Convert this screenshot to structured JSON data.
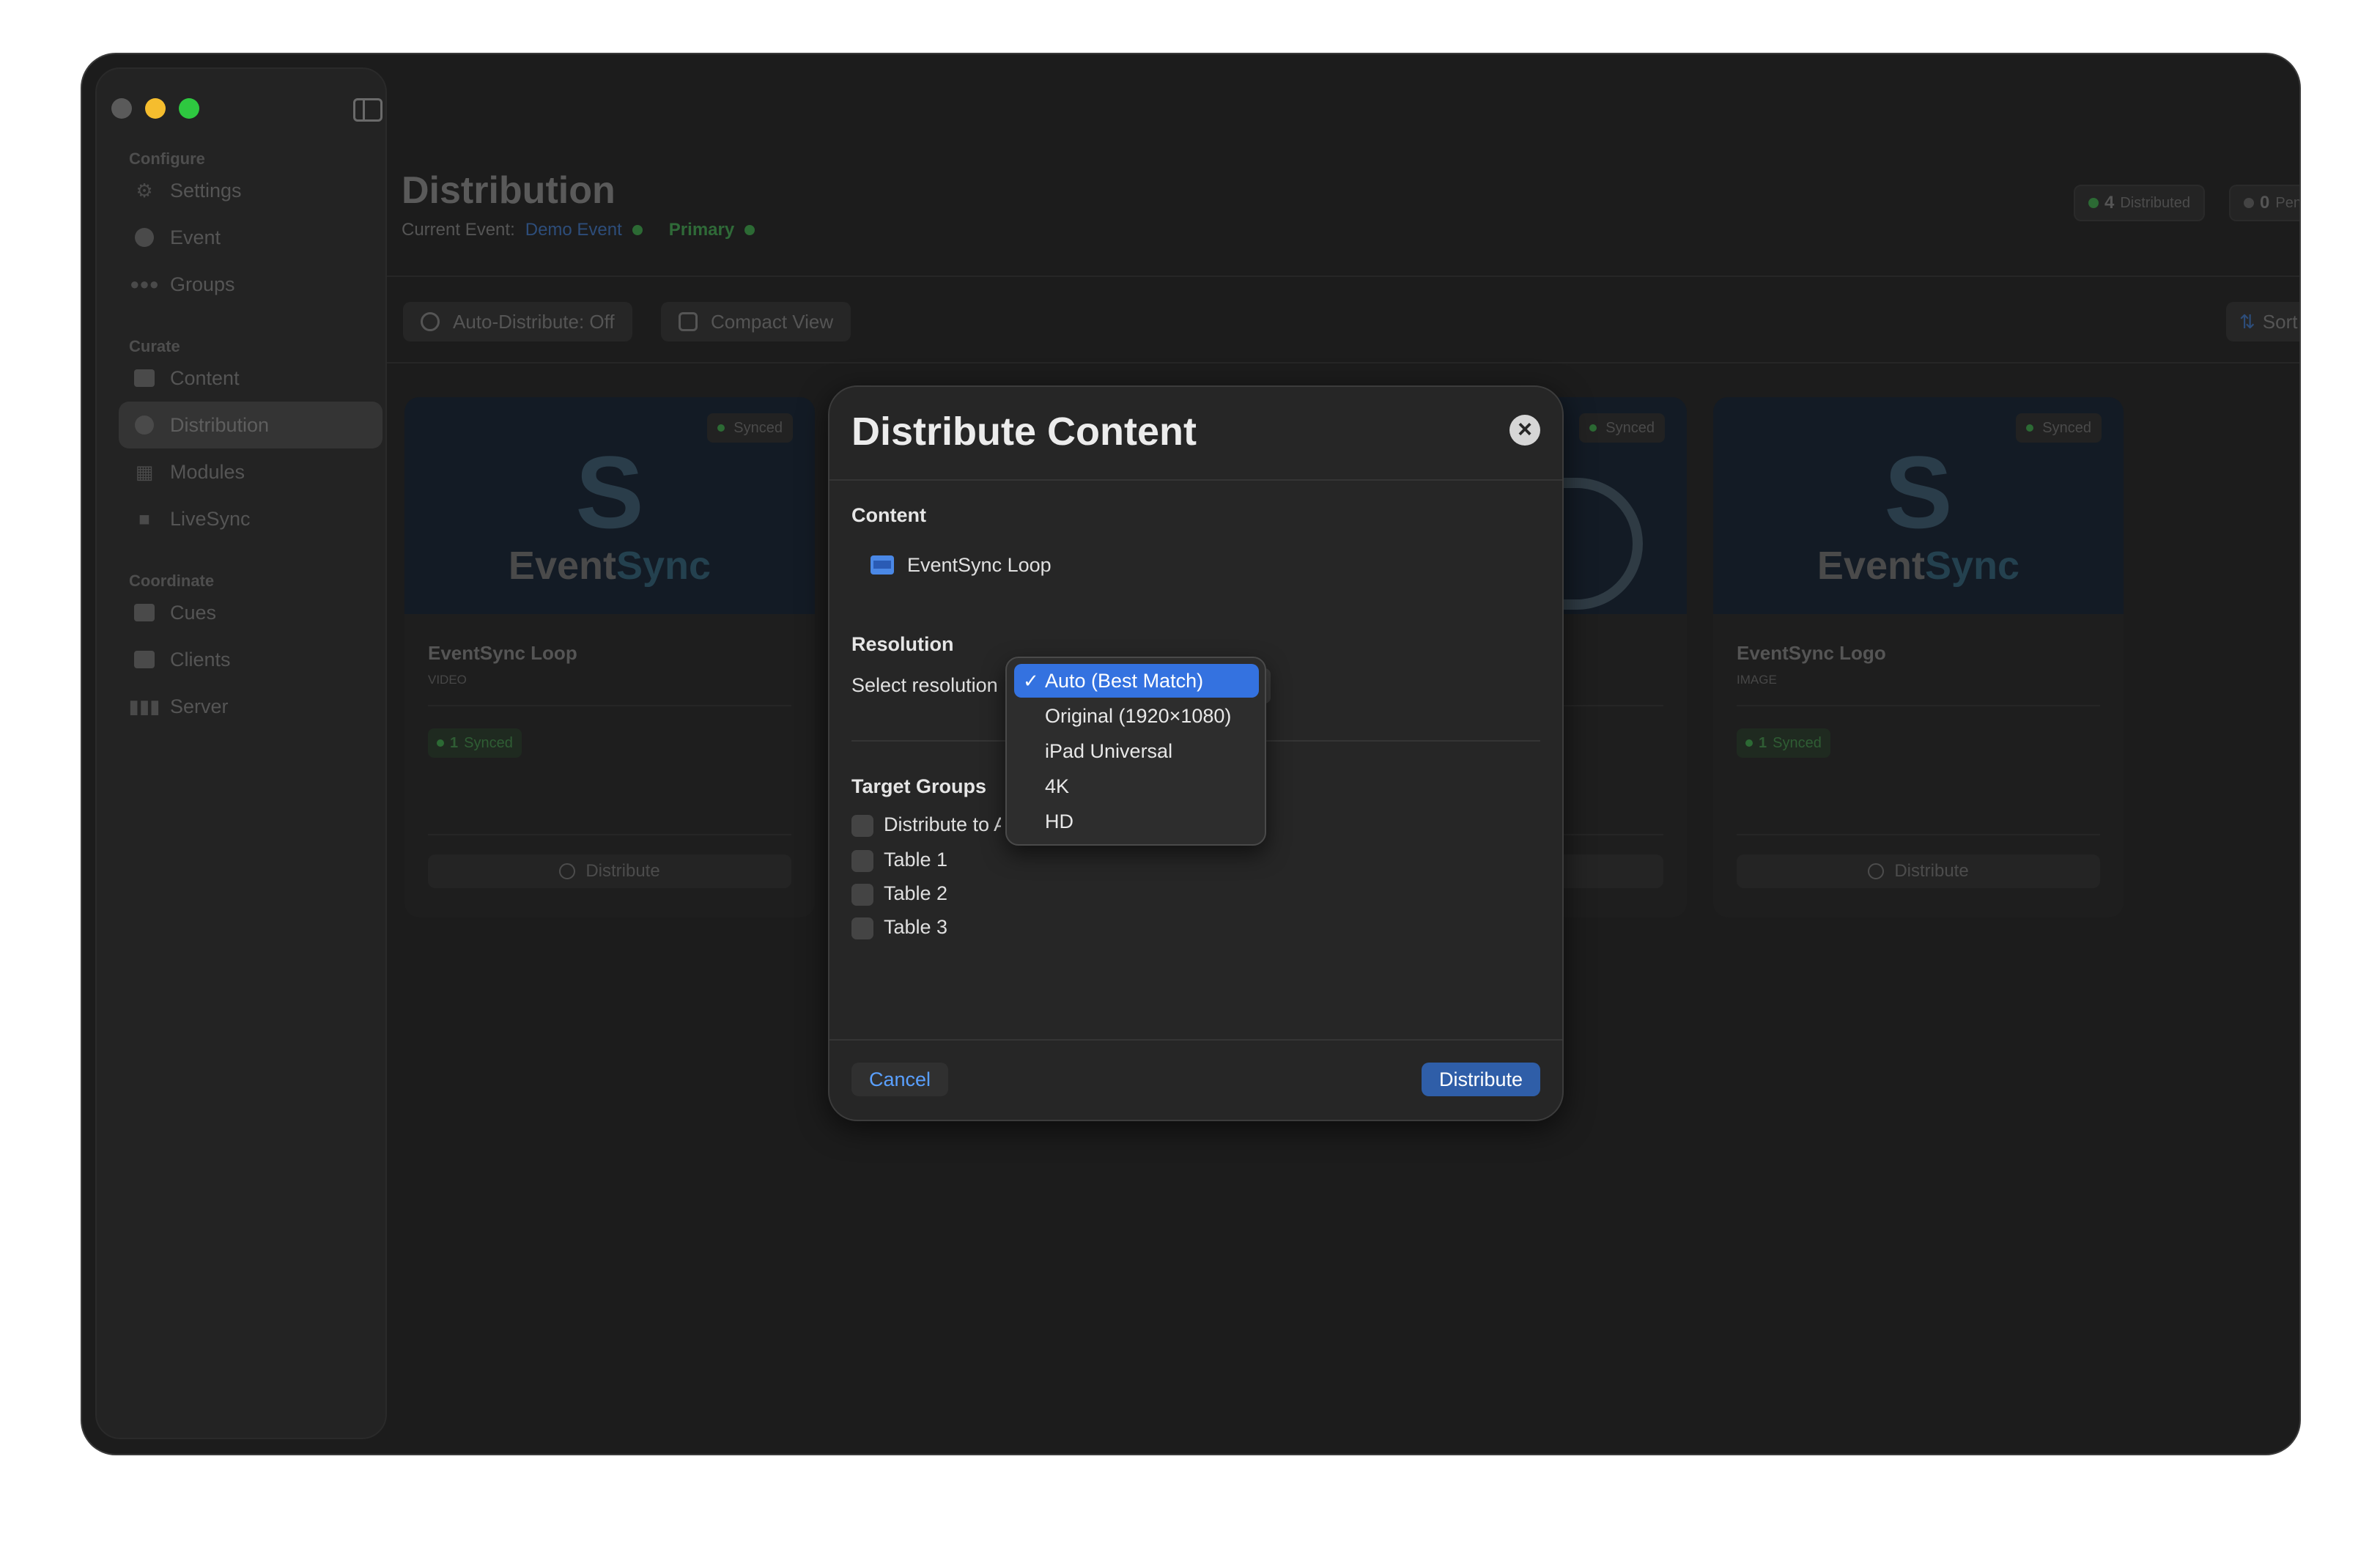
{
  "sidebar": {
    "sections": [
      {
        "title": "Configure",
        "items": [
          {
            "label": "Settings",
            "icon": "gear-icon"
          },
          {
            "label": "Event",
            "icon": "event-icon"
          },
          {
            "label": "Groups",
            "icon": "groups-icon"
          }
        ]
      },
      {
        "title": "Curate",
        "items": [
          {
            "label": "Content",
            "icon": "content-icon"
          },
          {
            "label": "Distribution",
            "icon": "distribution-icon"
          },
          {
            "label": "Modules",
            "icon": "modules-icon"
          },
          {
            "label": "LiveSync",
            "icon": "camera-icon"
          }
        ]
      },
      {
        "title": "Coordinate",
        "items": [
          {
            "label": "Cues",
            "icon": "cues-icon"
          },
          {
            "label": "Clients",
            "icon": "clients-icon"
          },
          {
            "label": "Server",
            "icon": "server-icon"
          }
        ]
      }
    ],
    "active": "Distribution"
  },
  "header": {
    "title": "Distribution",
    "current_event_label": "Current Event:",
    "event_name": "Demo Event",
    "primary_label": "Primary",
    "distributed_count": "4",
    "distributed_label": "Distributed",
    "pending_count": "0",
    "pending_label": "Pending"
  },
  "toolbar": {
    "auto_distribute": "Auto-Distribute: Off",
    "compact_view": "Compact View",
    "sort": "Sort"
  },
  "cards": [
    {
      "title": "EventSync Loop",
      "type": "VIDEO",
      "badge": "Synced",
      "synced_count": "1",
      "synced_label": "Synced",
      "action": "Distribute",
      "logo_a": "Event",
      "logo_b": "Sync"
    },
    {
      "title": "EventSync Logo",
      "type": "IMAGE",
      "badge": "Synced",
      "synced_count": "1",
      "synced_label": "Synced",
      "action": "Distribute",
      "logo_a": "Event",
      "logo_b": "Sync"
    }
  ],
  "middle_card_badge": "Synced",
  "modal": {
    "title": "Distribute Content",
    "content_label": "Content",
    "content_item": "EventSync Loop",
    "resolution_label": "Resolution",
    "select_resolution_label": "Select resolution",
    "target_groups_label": "Target Groups",
    "groups": [
      "Distribute to A",
      "Table 1",
      "Table 2",
      "Table 3"
    ],
    "cancel": "Cancel",
    "distribute": "Distribute"
  },
  "dropdown": {
    "options": [
      "Auto (Best Match)",
      "Original (1920×1080)",
      "iPad Universal",
      "4K",
      "HD"
    ],
    "selected_index": 0
  },
  "colors": {
    "accent": "#3472e0",
    "primary_button": "#2f5ea8",
    "link": "#5aa0ff",
    "synced_green": "#2c6a34"
  }
}
